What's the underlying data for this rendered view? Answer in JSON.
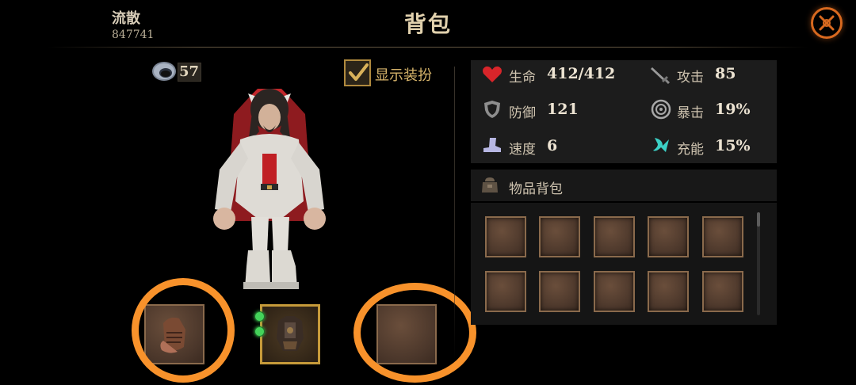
{
  "header": {
    "player_name": "流散",
    "player_id": "847741",
    "title": "背包"
  },
  "currency": {
    "icon": "ring-currency-icon",
    "value": "57"
  },
  "show_outfit": {
    "label": "显示装扮",
    "checked": true
  },
  "stats": [
    {
      "icon": "heart-icon",
      "label": "生命",
      "value": "412/412",
      "color": "#d8252a"
    },
    {
      "icon": "sword-icon",
      "label": "攻击",
      "value": "85",
      "color": "#9a9a9a"
    },
    {
      "icon": "shield-icon",
      "label": "防御",
      "value": "121",
      "color": "#9a9a9a"
    },
    {
      "icon": "crit-icon",
      "label": "暴击",
      "value": "19%",
      "color": "#a8a8a8"
    },
    {
      "icon": "boot-icon",
      "label": "速度",
      "value": "6",
      "color": "#b7b7e3"
    },
    {
      "icon": "energy-icon",
      "label": "充能",
      "value": "15%",
      "color": "#3bd0c5"
    }
  ],
  "inventory": {
    "title": "物品背包",
    "icon": "bag-icon",
    "slot_count": 10
  },
  "equipment": [
    {
      "name": "gloves-slot",
      "icon": "gauntlet-icon",
      "highlighted": true
    },
    {
      "name": "armor-slot",
      "icon": "armor-icon",
      "highlighted": false,
      "gems": 2
    },
    {
      "name": "empty-slot",
      "icon": "",
      "highlighted": true
    }
  ],
  "colors": {
    "accent_orange": "#f8922b",
    "gold": "#c69a3a",
    "panel": "#1c1c1c"
  }
}
